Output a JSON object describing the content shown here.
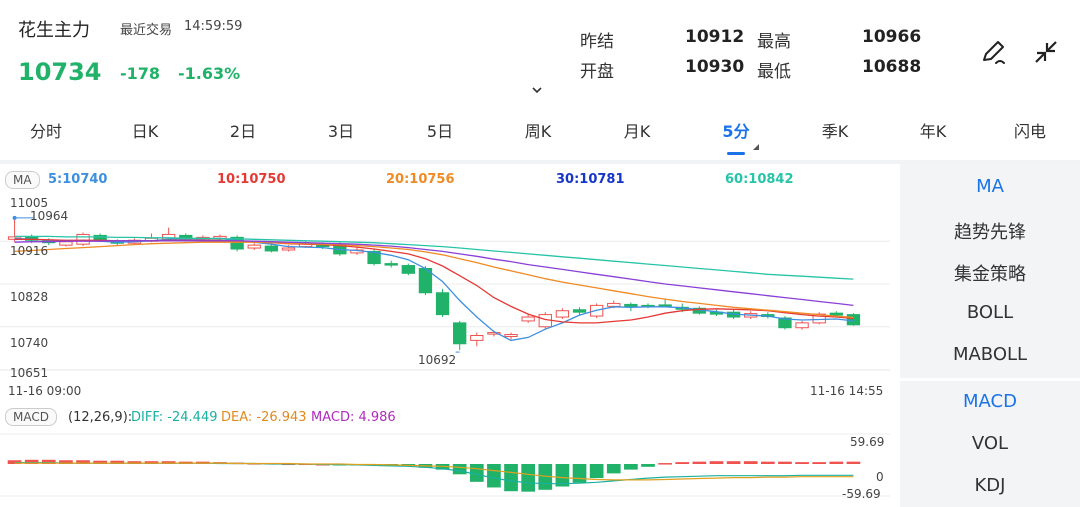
{
  "header": {
    "instrument": "花生主力",
    "last_trade_label": "最近交易",
    "last_trade_time": "14:59:59",
    "price": "10734",
    "change": "-178",
    "change_pct": "-1.63%",
    "quote": {
      "prev_settle_label": "昨结",
      "prev_settle": "10912",
      "high_label": "最高",
      "high": "10966",
      "open_label": "开盘",
      "open": "10930",
      "low_label": "最低",
      "low": "10688"
    },
    "icons": [
      "edit-pen-icon",
      "collapse-arrows-icon",
      "chevron-down-icon"
    ]
  },
  "tabs": [
    "分时",
    "日K",
    "2日",
    "3日",
    "5日",
    "周K",
    "月K",
    "5分",
    "季K",
    "年K",
    "闪电"
  ],
  "active_tab": "5分",
  "ma_bar": {
    "chip": "MA",
    "items": [
      {
        "text": "5:10740",
        "color": "#3d8fe0"
      },
      {
        "text": "10:10750",
        "color": "#e53935"
      },
      {
        "text": "20:10756",
        "color": "#f08a24"
      },
      {
        "text": "30:10781",
        "color": "#1636c8"
      },
      {
        "text": "60:10842",
        "color": "#27c4a8"
      }
    ]
  },
  "side_menu": {
    "main_indicators": [
      "MA",
      "趋势先锋",
      "集金策略",
      "BOLL",
      "MABOLL"
    ],
    "sub_indicators": [
      "MACD",
      "VOL",
      "KDJ"
    ],
    "active_main": "MA",
    "active_sub": "MACD"
  },
  "price_axis": [
    "11005",
    "10916",
    "10828",
    "10740",
    "10651"
  ],
  "time_axis": {
    "start": "11-16 09:00",
    "end": "11-16 14:55"
  },
  "annotations": {
    "high": "10964",
    "low": "10692"
  },
  "macd_bar": {
    "chip": "MACD",
    "params": "(12,26,9):",
    "diff": "DIFF: -24.449",
    "dea": "DEA: -26.943",
    "macd": "MACD: 4.986",
    "axis_top": "59.69",
    "axis_zero": "0",
    "axis_bottom": "-59.69"
  },
  "colors": {
    "up": "#ef5350",
    "down": "#21b269",
    "accent": "#1a73e8"
  },
  "chart_data": {
    "type": "candlestick",
    "interval": "5分",
    "ylim": [
      10651,
      11005
    ],
    "candles": [
      {
        "o": 10920,
        "c": 10925,
        "h": 10964,
        "l": 10915
      },
      {
        "o": 10925,
        "c": 10918,
        "h": 10930,
        "l": 10912
      },
      {
        "o": 10918,
        "c": 10913,
        "h": 10922,
        "l": 10908
      },
      {
        "o": 10908,
        "c": 10915,
        "h": 10918,
        "l": 10905
      },
      {
        "o": 10910,
        "c": 10930,
        "h": 10934,
        "l": 10906
      },
      {
        "o": 10928,
        "c": 10918,
        "h": 10932,
        "l": 10915
      },
      {
        "o": 10915,
        "c": 10912,
        "h": 10920,
        "l": 10908
      },
      {
        "o": 10912,
        "c": 10918,
        "h": 10922,
        "l": 10909
      },
      {
        "o": 10916,
        "c": 10922,
        "h": 10932,
        "l": 10914
      },
      {
        "o": 10920,
        "c": 10930,
        "h": 10944,
        "l": 10918
      },
      {
        "o": 10928,
        "c": 10920,
        "h": 10932,
        "l": 10915
      },
      {
        "o": 10918,
        "c": 10924,
        "h": 10928,
        "l": 10914
      },
      {
        "o": 10922,
        "c": 10926,
        "h": 10930,
        "l": 10918
      },
      {
        "o": 10924,
        "c": 10900,
        "h": 10928,
        "l": 10895
      },
      {
        "o": 10902,
        "c": 10908,
        "h": 10912,
        "l": 10898
      },
      {
        "o": 10906,
        "c": 10896,
        "h": 10910,
        "l": 10893
      },
      {
        "o": 10898,
        "c": 10902,
        "h": 10908,
        "l": 10895
      },
      {
        "o": 10905,
        "c": 10912,
        "h": 10916,
        "l": 10902
      },
      {
        "o": 10910,
        "c": 10905,
        "h": 10914,
        "l": 10900
      },
      {
        "o": 10910,
        "c": 10890,
        "h": 10914,
        "l": 10886
      },
      {
        "o": 10892,
        "c": 10898,
        "h": 10905,
        "l": 10888
      },
      {
        "o": 10895,
        "c": 10870,
        "h": 10900,
        "l": 10866
      },
      {
        "o": 10870,
        "c": 10868,
        "h": 10876,
        "l": 10862
      },
      {
        "o": 10866,
        "c": 10850,
        "h": 10870,
        "l": 10846
      },
      {
        "o": 10860,
        "c": 10810,
        "h": 10865,
        "l": 10805
      },
      {
        "o": 10810,
        "c": 10765,
        "h": 10818,
        "l": 10760
      },
      {
        "o": 10748,
        "c": 10705,
        "h": 10752,
        "l": 10692
      },
      {
        "o": 10712,
        "c": 10722,
        "h": 10728,
        "l": 10700
      },
      {
        "o": 10725,
        "c": 10728,
        "h": 10732,
        "l": 10720
      },
      {
        "o": 10720,
        "c": 10724,
        "h": 10728,
        "l": 10714
      },
      {
        "o": 10752,
        "c": 10760,
        "h": 10766,
        "l": 10748
      },
      {
        "o": 10740,
        "c": 10765,
        "h": 10770,
        "l": 10735
      },
      {
        "o": 10760,
        "c": 10773,
        "h": 10778,
        "l": 10756
      },
      {
        "o": 10775,
        "c": 10770,
        "h": 10780,
        "l": 10765
      },
      {
        "o": 10762,
        "c": 10784,
        "h": 10788,
        "l": 10758
      },
      {
        "o": 10782,
        "c": 10788,
        "h": 10794,
        "l": 10778
      },
      {
        "o": 10786,
        "c": 10782,
        "h": 10790,
        "l": 10772
      },
      {
        "o": 10784,
        "c": 10783,
        "h": 10788,
        "l": 10778
      },
      {
        "o": 10785,
        "c": 10783,
        "h": 10798,
        "l": 10780
      },
      {
        "o": 10780,
        "c": 10776,
        "h": 10788,
        "l": 10770
      },
      {
        "o": 10778,
        "c": 10768,
        "h": 10782,
        "l": 10765
      },
      {
        "o": 10770,
        "c": 10766,
        "h": 10775,
        "l": 10762
      },
      {
        "o": 10770,
        "c": 10760,
        "h": 10775,
        "l": 10756
      },
      {
        "o": 10760,
        "c": 10767,
        "h": 10772,
        "l": 10756
      },
      {
        "o": 10765,
        "c": 10761,
        "h": 10770,
        "l": 10757
      },
      {
        "o": 10758,
        "c": 10738,
        "h": 10762,
        "l": 10734
      },
      {
        "o": 10738,
        "c": 10748,
        "h": 10752,
        "l": 10734
      },
      {
        "o": 10748,
        "c": 10766,
        "h": 10770,
        "l": 10745
      },
      {
        "o": 10768,
        "c": 10764,
        "h": 10772,
        "l": 10760
      },
      {
        "o": 10765,
        "c": 10744,
        "h": 10768,
        "l": 10742
      }
    ],
    "ma": [
      {
        "name": "5",
        "color": "#3d8fe0",
        "values": [
          10922,
          10920,
          10918,
          10916,
          10918,
          10916,
          10914,
          10915,
          10917,
          10920,
          10921,
          10921,
          10922,
          10917,
          10914,
          10910,
          10905,
          10904,
          10903,
          10899,
          10897,
          10893,
          10887,
          10878,
          10860,
          10833,
          10794,
          10760,
          10730,
          10712,
          10718,
          10735,
          10748,
          10764,
          10774,
          10781,
          10780,
          10781,
          10781,
          10779,
          10775,
          10771,
          10766,
          10764,
          10762,
          10756,
          10754,
          10755,
          10756,
          10752
        ]
      },
      {
        "name": "10",
        "color": "#e53935",
        "values": [
          10920,
          10920,
          10919,
          10918,
          10918,
          10918,
          10917,
          10917,
          10917,
          10918,
          10918,
          10918,
          10918,
          10916,
          10915,
          10913,
          10911,
          10910,
          10909,
          10907,
          10904,
          10900,
          10895,
          10890,
          10880,
          10865,
          10845,
          10825,
          10800,
          10782,
          10766,
          10755,
          10750,
          10748,
          10748,
          10751,
          10754,
          10760,
          10768,
          10773,
          10776,
          10777,
          10776,
          10775,
          10773,
          10769,
          10765,
          10762,
          10760,
          10757
        ]
      },
      {
        "name": "20",
        "color": "#f08a24",
        "values": [
          10895,
          10897,
          10899,
          10901,
          10903,
          10905,
          10907,
          10909,
          10911,
          10912,
          10913,
          10914,
          10914,
          10914,
          10914,
          10913,
          10912,
          10911,
          10910,
          10909,
          10907,
          10905,
          10902,
          10899,
          10894,
          10888,
          10880,
          10872,
          10863,
          10855,
          10847,
          10839,
          10832,
          10826,
          10820,
          10814,
          10808,
          10802,
          10797,
          10792,
          10788,
          10784,
          10780,
          10777,
          10774,
          10771,
          10768,
          10765,
          10762,
          10759
        ]
      },
      {
        "name": "30",
        "color": "#8a3fd6",
        "values": [
          10914,
          10915,
          10915,
          10916,
          10916,
          10916,
          10917,
          10917,
          10917,
          10917,
          10917,
          10917,
          10917,
          10917,
          10916,
          10915,
          10914,
          10913,
          10912,
          10911,
          10910,
          10908,
          10906,
          10903,
          10899,
          10895,
          10890,
          10885,
          10879,
          10874,
          10868,
          10863,
          10858,
          10853,
          10848,
          10843,
          10838,
          10833,
          10828,
          10824,
          10820,
          10816,
          10812,
          10808,
          10804,
          10800,
          10796,
          10792,
          10788,
          10784
        ]
      },
      {
        "name": "60",
        "color": "#27c4a8",
        "values": [
          10926,
          10926,
          10926,
          10925,
          10925,
          10925,
          10924,
          10924,
          10923,
          10923,
          10922,
          10922,
          10921,
          10921,
          10920,
          10919,
          10918,
          10917,
          10916,
          10915,
          10914,
          10913,
          10911,
          10909,
          10907,
          10905,
          10902,
          10899,
          10896,
          10893,
          10890,
          10887,
          10884,
          10881,
          10878,
          10875,
          10872,
          10869,
          10866,
          10863,
          10860,
          10857,
          10854,
          10851,
          10848,
          10846,
          10844,
          10842,
          10840,
          10838
        ]
      }
    ],
    "macd_hist": [
      8,
      9,
      9,
      8,
      8,
      7,
      7,
      6,
      6,
      6,
      5,
      5,
      4,
      3,
      2,
      2,
      1,
      1,
      0,
      -1,
      -2,
      -3,
      -4,
      -5,
      -8,
      -12,
      -22,
      -38,
      -50,
      -58,
      -59,
      -55,
      -48,
      -40,
      -30,
      -20,
      -12,
      -6,
      2,
      4,
      5,
      6,
      6,
      6,
      5,
      5,
      4,
      4,
      5,
      5
    ],
    "diff": [
      3,
      3,
      3,
      2,
      2,
      2,
      2,
      2,
      2,
      2,
      2,
      2,
      1,
      1,
      1,
      0,
      0,
      0,
      -1,
      -1,
      -2,
      -3,
      -4,
      -5,
      -7,
      -10,
      -15,
      -22,
      -30,
      -36,
      -40,
      -42,
      -42,
      -41,
      -39,
      -36,
      -33,
      -30,
      -28,
      -27,
      -26,
      -25,
      -25,
      -25,
      -25,
      -25,
      -24,
      -24,
      -24,
      -24
    ],
    "dea": [
      2,
      2,
      2,
      2,
      2,
      2,
      2,
      2,
      2,
      2,
      2,
      2,
      2,
      1,
      1,
      1,
      1,
      0,
      0,
      0,
      -1,
      -1,
      -2,
      -3,
      -4,
      -5,
      -7,
      -10,
      -14,
      -18,
      -22,
      -26,
      -29,
      -31,
      -33,
      -34,
      -34,
      -34,
      -33,
      -32,
      -31,
      -30,
      -29,
      -29,
      -28,
      -28,
      -27,
      -27,
      -27,
      -27
    ]
  }
}
